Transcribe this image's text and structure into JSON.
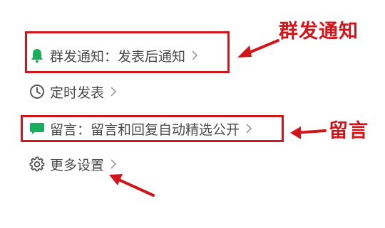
{
  "settings": {
    "notify": {
      "label": "群发通知：发表后通知",
      "icon": "bell-icon",
      "icon_color": "#1aad5c"
    },
    "schedule": {
      "label": "定时发表",
      "icon": "clock-icon"
    },
    "comment": {
      "label": "留言：留言和回复自动精选公开",
      "icon": "chat-bubble-icon",
      "icon_color": "#1aad5c"
    },
    "more": {
      "label": "更多设置",
      "icon": "gear-icon"
    }
  },
  "annotations": {
    "notify_callout": "群发通知",
    "comment_callout": "留言",
    "color": "#d0161b"
  }
}
